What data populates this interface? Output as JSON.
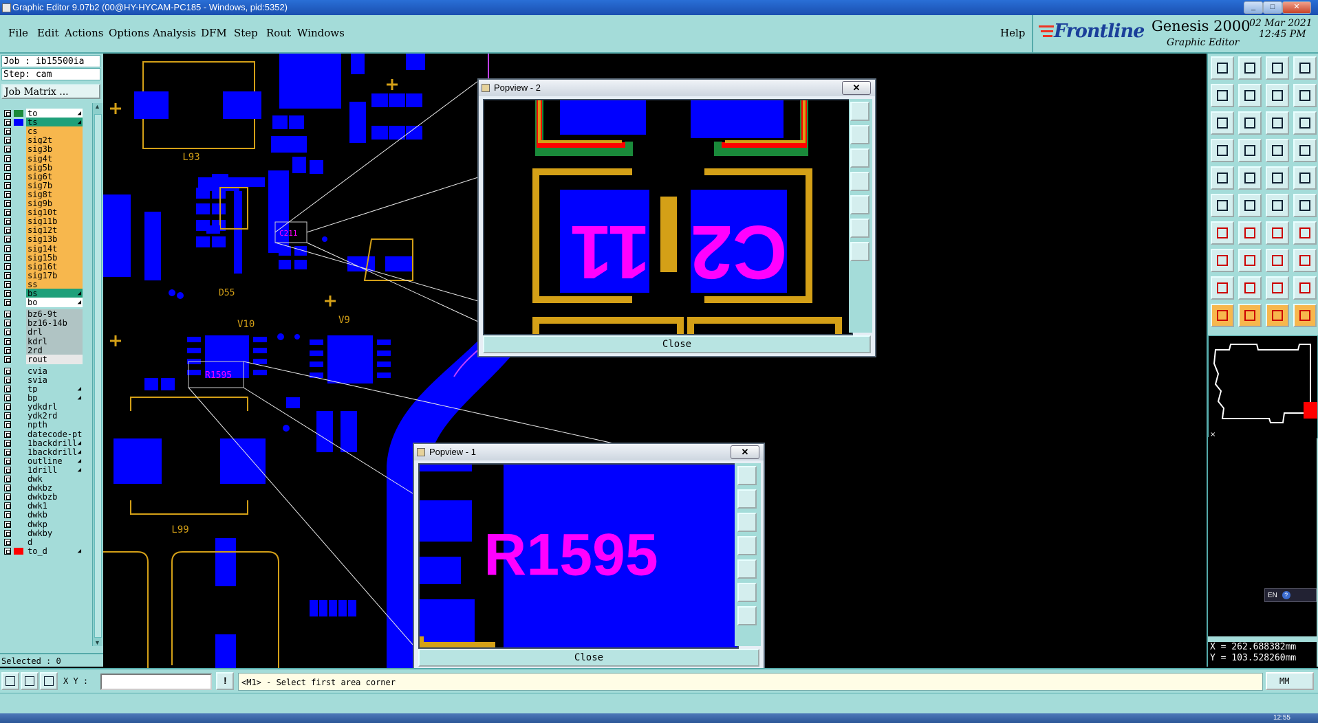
{
  "window": {
    "title": "Graphic Editor 9.07b2 (00@HY-HYCAM-PC185 - Windows, pid:5352)",
    "controls": [
      "_",
      "□",
      "✕"
    ]
  },
  "menu": {
    "items": [
      "File",
      "Edit",
      "Actions",
      "Options",
      "Analysis",
      "DFM",
      "Step",
      "Rout",
      "Windows"
    ],
    "help": "Help"
  },
  "brand": {
    "logo": "Frontline",
    "product": "Genesis 2000",
    "module": "Graphic Editor",
    "date": "02 Mar 2021",
    "time": "12:45 PM"
  },
  "job": {
    "job_line": "Job : ib15500ia",
    "step_line": "Step: cam",
    "matrix_button": "Job Matrix ..."
  },
  "layers": [
    {
      "name": "to",
      "bg": "#ffffff",
      "sw": "#1a8a3a",
      "mark": "◢"
    },
    {
      "name": "ts",
      "bg": "#1fa07a",
      "sw": "#0000ff",
      "mark": "◢"
    },
    {
      "name": "cs",
      "bg": "#f7b74d",
      "sw": "",
      "mark": ""
    },
    {
      "name": "sig2t",
      "bg": "#f7b74d",
      "sw": "",
      "mark": ""
    },
    {
      "name": "sig3b",
      "bg": "#f7b74d",
      "sw": "",
      "mark": ""
    },
    {
      "name": "sig4t",
      "bg": "#f7b74d",
      "sw": "",
      "mark": ""
    },
    {
      "name": "sig5b",
      "bg": "#f7b74d",
      "sw": "",
      "mark": ""
    },
    {
      "name": "sig6t",
      "bg": "#f7b74d",
      "sw": "",
      "mark": ""
    },
    {
      "name": "sig7b",
      "bg": "#f7b74d",
      "sw": "",
      "mark": ""
    },
    {
      "name": "sig8t",
      "bg": "#f7b74d",
      "sw": "",
      "mark": ""
    },
    {
      "name": "sig9b",
      "bg": "#f7b74d",
      "sw": "",
      "mark": ""
    },
    {
      "name": "sig10t",
      "bg": "#f7b74d",
      "sw": "",
      "mark": ""
    },
    {
      "name": "sig11b",
      "bg": "#f7b74d",
      "sw": "",
      "mark": ""
    },
    {
      "name": "sig12t",
      "bg": "#f7b74d",
      "sw": "",
      "mark": ""
    },
    {
      "name": "sig13b",
      "bg": "#f7b74d",
      "sw": "",
      "mark": ""
    },
    {
      "name": "sig14t",
      "bg": "#f7b74d",
      "sw": "",
      "mark": ""
    },
    {
      "name": "sig15b",
      "bg": "#f7b74d",
      "sw": "",
      "mark": ""
    },
    {
      "name": "sig16t",
      "bg": "#f7b74d",
      "sw": "",
      "mark": ""
    },
    {
      "name": "sig17b",
      "bg": "#f7b74d",
      "sw": "",
      "mark": ""
    },
    {
      "name": "ss",
      "bg": "#f7b74d",
      "sw": "",
      "mark": ""
    },
    {
      "name": "bs",
      "bg": "#1fa07a",
      "sw": "",
      "mark": "◢"
    },
    {
      "name": "bo",
      "bg": "#ffffff",
      "sw": "",
      "mark": "◢"
    },
    {
      "name": "bz6-9t",
      "bg": "#b0c4c4",
      "sw": "",
      "mark": ""
    },
    {
      "name": "bz16-14b",
      "bg": "#b0c4c4",
      "sw": "",
      "mark": ""
    },
    {
      "name": "drl",
      "bg": "#b0c4c4",
      "sw": "",
      "mark": ""
    },
    {
      "name": "kdrl",
      "bg": "#b0c4c4",
      "sw": "",
      "mark": ""
    },
    {
      "name": "2rd",
      "bg": "#b0c4c4",
      "sw": "",
      "mark": ""
    },
    {
      "name": "rout",
      "bg": "#e8e8e8",
      "sw": "",
      "mark": ""
    },
    {
      "name": "cvia",
      "bg": "#a4dcd9",
      "sw": "",
      "mark": ""
    },
    {
      "name": "svia",
      "bg": "#a4dcd9",
      "sw": "",
      "mark": ""
    },
    {
      "name": "tp",
      "bg": "#a4dcd9",
      "sw": "",
      "mark": "◢"
    },
    {
      "name": "bp",
      "bg": "#a4dcd9",
      "sw": "",
      "mark": "◢"
    },
    {
      "name": "ydkdrl",
      "bg": "#a4dcd9",
      "sw": "",
      "mark": ""
    },
    {
      "name": "ydk2rd",
      "bg": "#a4dcd9",
      "sw": "",
      "mark": ""
    },
    {
      "name": "npth",
      "bg": "#a4dcd9",
      "sw": "",
      "mark": ""
    },
    {
      "name": "datecode-pt",
      "bg": "#a4dcd9",
      "sw": "",
      "mark": ""
    },
    {
      "name": "1backdrill",
      "bg": "#a4dcd9",
      "sw": "",
      "mark": "◢"
    },
    {
      "name": "1backdrill",
      "bg": "#a4dcd9",
      "sw": "",
      "mark": "◢"
    },
    {
      "name": "outline",
      "bg": "#a4dcd9",
      "sw": "",
      "mark": "◢"
    },
    {
      "name": "1drill",
      "bg": "#a4dcd9",
      "sw": "",
      "mark": "◢"
    },
    {
      "name": "dwk",
      "bg": "#a4dcd9",
      "sw": "",
      "mark": ""
    },
    {
      "name": "dwkbz",
      "bg": "#a4dcd9",
      "sw": "",
      "mark": ""
    },
    {
      "name": "dwkbzb",
      "bg": "#a4dcd9",
      "sw": "",
      "mark": ""
    },
    {
      "name": "dwk1",
      "bg": "#a4dcd9",
      "sw": "",
      "mark": ""
    },
    {
      "name": "dwkb",
      "bg": "#a4dcd9",
      "sw": "",
      "mark": ""
    },
    {
      "name": "dwkp",
      "bg": "#a4dcd9",
      "sw": "",
      "mark": ""
    },
    {
      "name": "dwkby",
      "bg": "#a4dcd9",
      "sw": "",
      "mark": ""
    },
    {
      "name": "d",
      "bg": "#a4dcd9",
      "sw": "",
      "mark": ""
    },
    {
      "name": "to_d",
      "bg": "#a4dcd9",
      "sw": "#ff0000",
      "mark": "◢"
    }
  ],
  "selected": "Selected : 0",
  "board_labels": [
    "L93",
    "D55",
    "V10",
    "V9",
    "L99",
    "C211",
    "R1595"
  ],
  "popview2": {
    "title": "Popview - 2",
    "close": "Close",
    "text_left": "11",
    "text_right": "C2"
  },
  "popview1": {
    "title": "Popview - 1",
    "close": "Close",
    "text": "R1595"
  },
  "coords": {
    "x": "X = 262.688382mm",
    "y": "Y = 103.528260mm"
  },
  "status": {
    "xy_label": "X Y :",
    "xy_value": "",
    "message": "<M1> - Select first area corner",
    "units": "MM",
    "lang": "EN"
  },
  "taskbar": {
    "clock": "12:55"
  },
  "colors": {
    "panel": "#a4dcd9",
    "pad": "#0000ff",
    "outline": "#d4a017",
    "silk": "#ff00ff",
    "mask": "#ff0000"
  }
}
